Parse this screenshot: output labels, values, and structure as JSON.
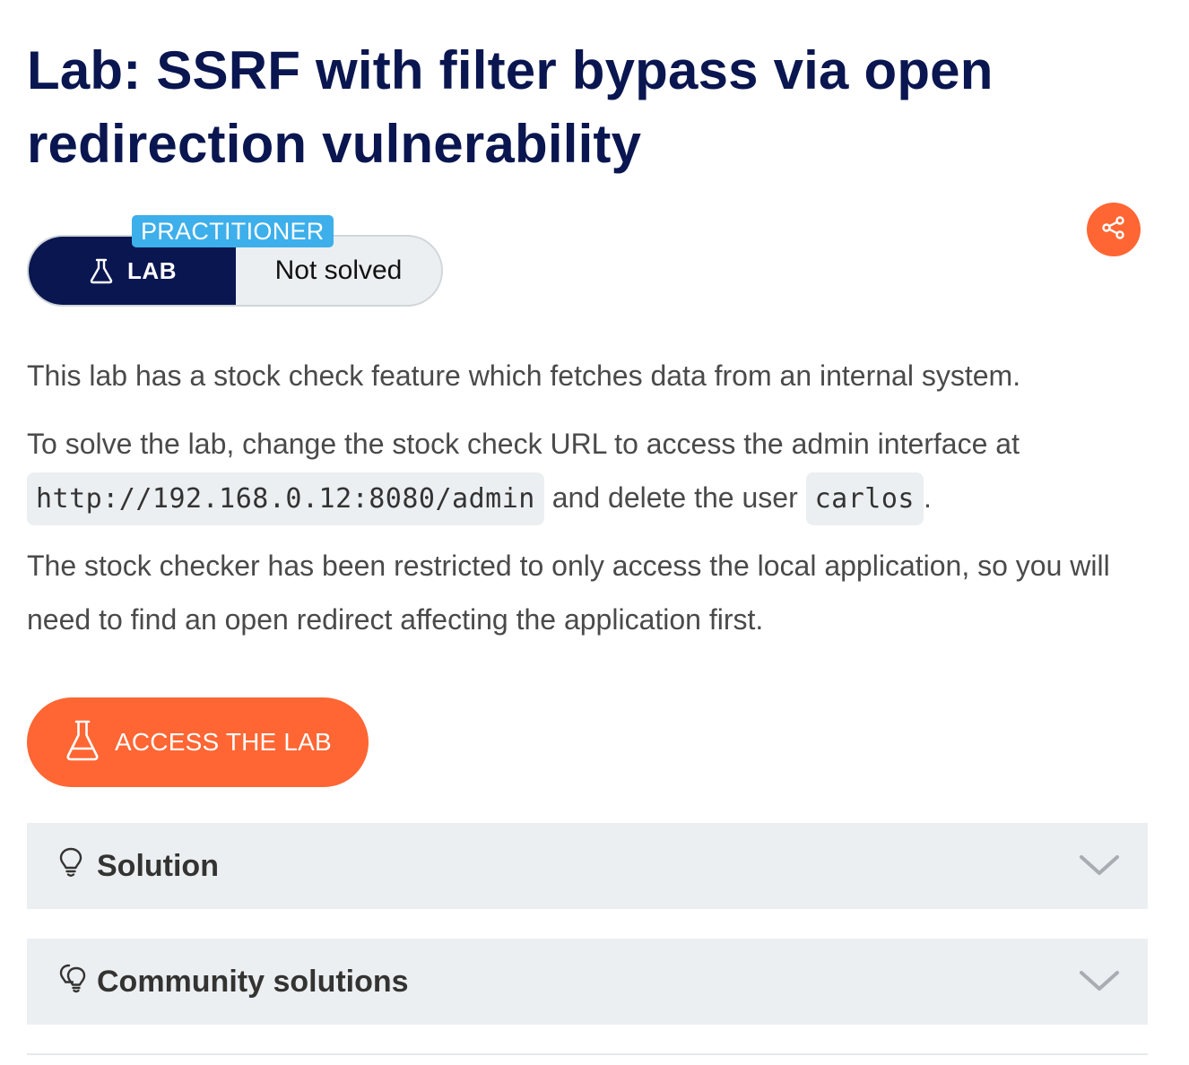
{
  "page_title": "Lab: SSRF with filter bypass via open redirection vulnerability",
  "badge": {
    "level": "PRACTITIONER",
    "type_label": "LAB",
    "status": "Not solved",
    "type_icon": "flask-icon"
  },
  "share": {
    "icon": "share-icon"
  },
  "description": {
    "p1": "This lab has a stock check feature which fetches data from an internal system.",
    "p2_before": "To solve the lab, change the stock check URL to access the admin interface at",
    "p2_url": "http://192.168.0.12:8080/admin",
    "p2_mid": "and delete the user",
    "p2_user": "carlos",
    "p2_end": ".",
    "p3": "The stock checker has been restricted to only access the local application, so you will need to find an open redirect affecting the application first."
  },
  "access_button": {
    "label": "ACCESS THE LAB",
    "icon": "flask-icon"
  },
  "accordions": [
    {
      "label": "Solution",
      "icon": "lightbulb-icon",
      "expanded": false
    },
    {
      "label": "Community solutions",
      "icon": "lightbulbs-icon",
      "expanded": false
    }
  ],
  "colors": {
    "title": "#0a1650",
    "accent": "#ff6633",
    "level_tag": "#3dafeb",
    "accordion_bg": "#eceff1"
  }
}
